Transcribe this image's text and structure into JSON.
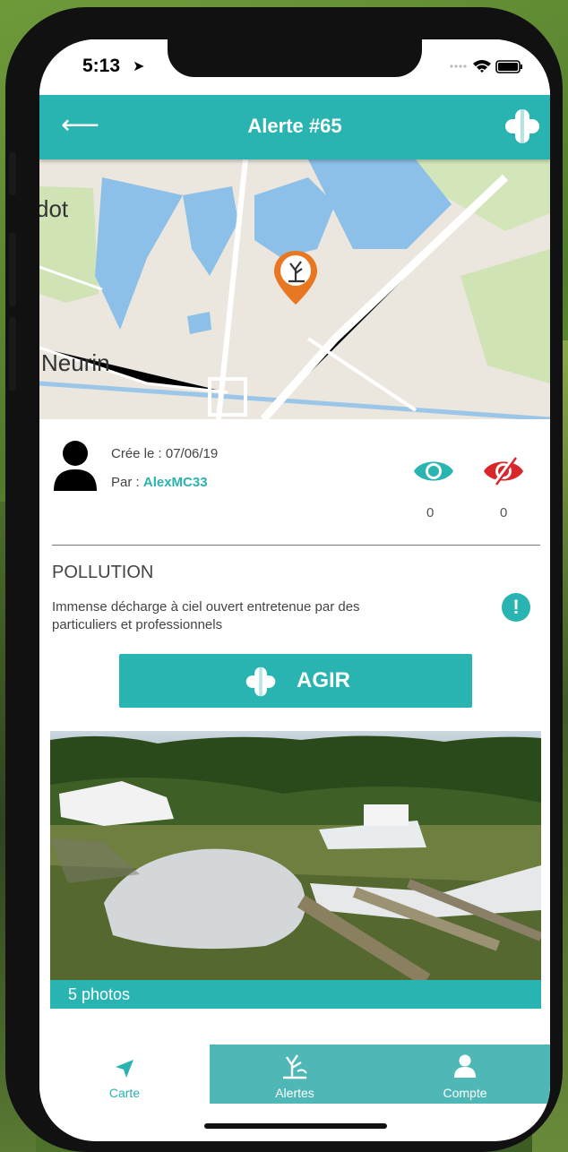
{
  "status": {
    "time": "5:13"
  },
  "header": {
    "title": "Alerte #65"
  },
  "map": {
    "labels": [
      "dot",
      "Neurin"
    ]
  },
  "alert": {
    "created_label": "Crée le : 07/06/19",
    "by_prefix": "Par : ",
    "author": "AlexMC33",
    "views_count": "0",
    "hidden_count": "0",
    "category": "POLLUTION",
    "description": "Immense décharge à ciel ouvert entretenue par des particuliers et professionnels",
    "info_symbol": "!"
  },
  "action": {
    "label": "AGIR"
  },
  "photos": {
    "caption": "5 photos"
  },
  "tabs": [
    {
      "label": "Carte",
      "icon": "navigation-arrow-icon",
      "active": true
    },
    {
      "label": "Alertes",
      "icon": "dead-tree-icon",
      "active": false
    },
    {
      "label": "Compte",
      "icon": "user-icon",
      "active": false
    }
  ],
  "colors": {
    "accent": "#29b3b1",
    "pin": "#e87722",
    "hidden_eye": "#d9262b"
  }
}
